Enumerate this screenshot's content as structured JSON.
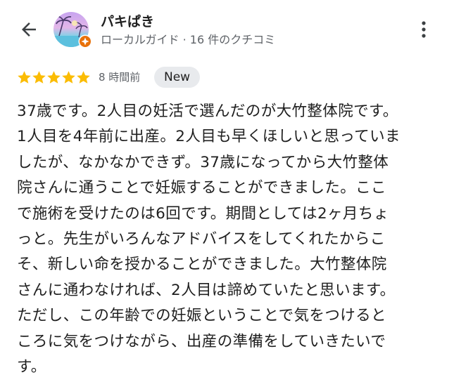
{
  "header": {
    "back_icon": "arrow-back-icon",
    "reviewer_name": "パキぱき",
    "reviewer_subtitle": "ローカルガイド · 16 件のクチコミ",
    "guide_badge_icon": "local-guide-badge-icon",
    "more_icon": "more-vert-icon"
  },
  "review": {
    "rating": 5,
    "rating_max": 5,
    "star_color": "#fbbc04",
    "time": "8 時間前",
    "badge": "New",
    "lines": [
      "37歳です。2人目の妊活で選んだのが大竹整体院です。",
      "1人目を4年前に出産。2人目も早くほしいと思っていま",
      "したが、なかなかできず。37歳になってから大竹整体",
      "院さんに通うことで妊娠することができました。ここ",
      "で施術を受けたのは6回です。期間としては2ヶ月ちょ",
      "っと。先生がいろんなアドバイスをしてくれたからこ",
      "そ、新しい命を授かることができました。大竹整体院",
      "さんに通わなければ、2人目は諦めていたと思います。",
      "ただし、この年齢での妊娠ということで気をつけると",
      "ころに気をつけながら、出産の準備をしていきたいで",
      "す。"
    ]
  }
}
